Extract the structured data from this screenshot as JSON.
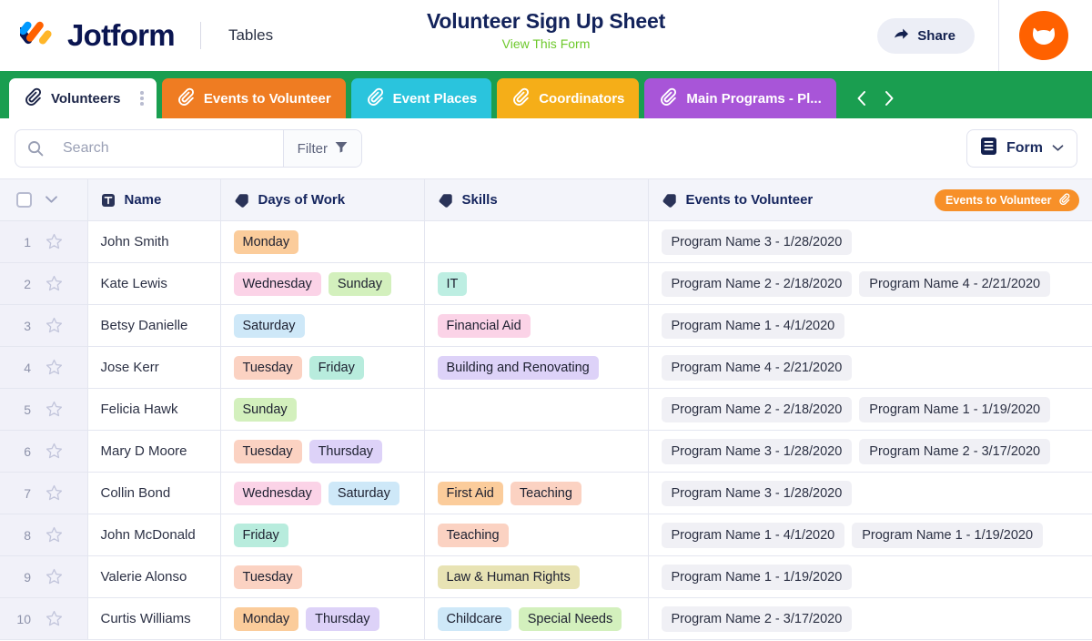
{
  "header": {
    "logo_name": "jotform-logo",
    "brand": "Jotform",
    "product": "Tables",
    "title": "Volunteer Sign Up Sheet",
    "subtitle": "View This Form",
    "share_label": "Share",
    "avatar_name": "user-avatar"
  },
  "tabs": {
    "items": [
      {
        "label": "Volunteers",
        "color": "#ffffff",
        "active": true
      },
      {
        "label": "Events to Volunteer",
        "color": "#ef7c22",
        "active": false
      },
      {
        "label": "Event Places",
        "color": "#2ac4dd",
        "active": false
      },
      {
        "label": "Coordinators",
        "color": "#f5ae18",
        "active": false
      },
      {
        "label": "Main Programs - Pl...",
        "color": "#a855d8",
        "active": false
      }
    ],
    "bar_color": "#1a9e50",
    "prev_label": "‹",
    "next_label": "›"
  },
  "toolbar": {
    "search_placeholder": "Search",
    "search_value": "",
    "filter_label": "Filter",
    "form_label": "Form"
  },
  "table": {
    "columns": [
      {
        "label": "Name",
        "type_icon": "text-field-icon"
      },
      {
        "label": "Days of Work",
        "type_icon": "tag-icon"
      },
      {
        "label": "Skills",
        "type_icon": "tag-icon"
      },
      {
        "label": "Events to Volunteer",
        "type_icon": "tag-icon"
      }
    ],
    "link_badge": "Events to Volunteer",
    "rows": [
      {
        "num": "1",
        "name": "John Smith",
        "days": [
          {
            "label": "Monday",
            "bg": "#fbcc9b"
          }
        ],
        "skills": [],
        "events": [
          "Program Name 3 - 1/28/2020"
        ]
      },
      {
        "num": "2",
        "name": "Kate Lewis",
        "days": [
          {
            "label": "Wednesday",
            "bg": "#fbd3e7"
          },
          {
            "label": "Sunday",
            "bg": "#d3f0bd"
          }
        ],
        "skills": [
          {
            "label": "IT",
            "bg": "#bdeee2"
          }
        ],
        "events": [
          "Program Name 2 - 2/18/2020",
          "Program Name 4 - 2/21/2020"
        ]
      },
      {
        "num": "3",
        "name": "Betsy Danielle",
        "days": [
          {
            "label": "Saturday",
            "bg": "#cee8f8"
          }
        ],
        "skills": [
          {
            "label": "Financial Aid",
            "bg": "#fbd3e7"
          }
        ],
        "events": [
          "Program Name 1 - 4/1/2020"
        ]
      },
      {
        "num": "4",
        "name": "Jose Kerr",
        "days": [
          {
            "label": "Tuesday",
            "bg": "#fbd2c2"
          },
          {
            "label": "Friday",
            "bg": "#b8ecdd"
          }
        ],
        "skills": [
          {
            "label": "Building and Renovating",
            "bg": "#ddd2f8"
          }
        ],
        "events": [
          "Program Name 4 - 2/21/2020"
        ]
      },
      {
        "num": "5",
        "name": "Felicia Hawk",
        "days": [
          {
            "label": "Sunday",
            "bg": "#d3f0bd"
          }
        ],
        "skills": [],
        "events": [
          "Program Name 2 - 2/18/2020",
          "Program Name 1 - 1/19/2020"
        ]
      },
      {
        "num": "6",
        "name": "Mary D Moore",
        "days": [
          {
            "label": "Tuesday",
            "bg": "#fbd2c2"
          },
          {
            "label": "Thursday",
            "bg": "#ddd2f8"
          }
        ],
        "skills": [],
        "events": [
          "Program Name 3 - 1/28/2020",
          "Program Name 2 - 3/17/2020"
        ]
      },
      {
        "num": "7",
        "name": "Collin Bond",
        "days": [
          {
            "label": "Wednesday",
            "bg": "#fbd3e7"
          },
          {
            "label": "Saturday",
            "bg": "#cee8f8"
          }
        ],
        "skills": [
          {
            "label": "First Aid",
            "bg": "#fbcc9b"
          },
          {
            "label": "Teaching",
            "bg": "#fbd2c2"
          }
        ],
        "events": [
          "Program Name 3 - 1/28/2020"
        ]
      },
      {
        "num": "8",
        "name": "John McDonald",
        "days": [
          {
            "label": "Friday",
            "bg": "#b8ecdd"
          }
        ],
        "skills": [
          {
            "label": "Teaching",
            "bg": "#fbd2c2"
          }
        ],
        "events": [
          "Program Name 1 - 4/1/2020",
          "Program Name 1 - 1/19/2020"
        ]
      },
      {
        "num": "9",
        "name": "Valerie Alonso",
        "days": [
          {
            "label": "Tuesday",
            "bg": "#fbd2c2"
          }
        ],
        "skills": [
          {
            "label": "Law & Human Rights",
            "bg": "#e8e3b4"
          }
        ],
        "events": [
          "Program Name 1 - 1/19/2020"
        ]
      },
      {
        "num": "10",
        "name": "Curtis Williams",
        "days": [
          {
            "label": "Monday",
            "bg": "#fbcc9b"
          },
          {
            "label": "Thursday",
            "bg": "#ddd2f8"
          }
        ],
        "skills": [
          {
            "label": "Childcare",
            "bg": "#cee8f8"
          },
          {
            "label": "Special Needs",
            "bg": "#d3f0bd"
          }
        ],
        "events": [
          "Program Name 2 - 3/17/2020"
        ]
      }
    ]
  }
}
